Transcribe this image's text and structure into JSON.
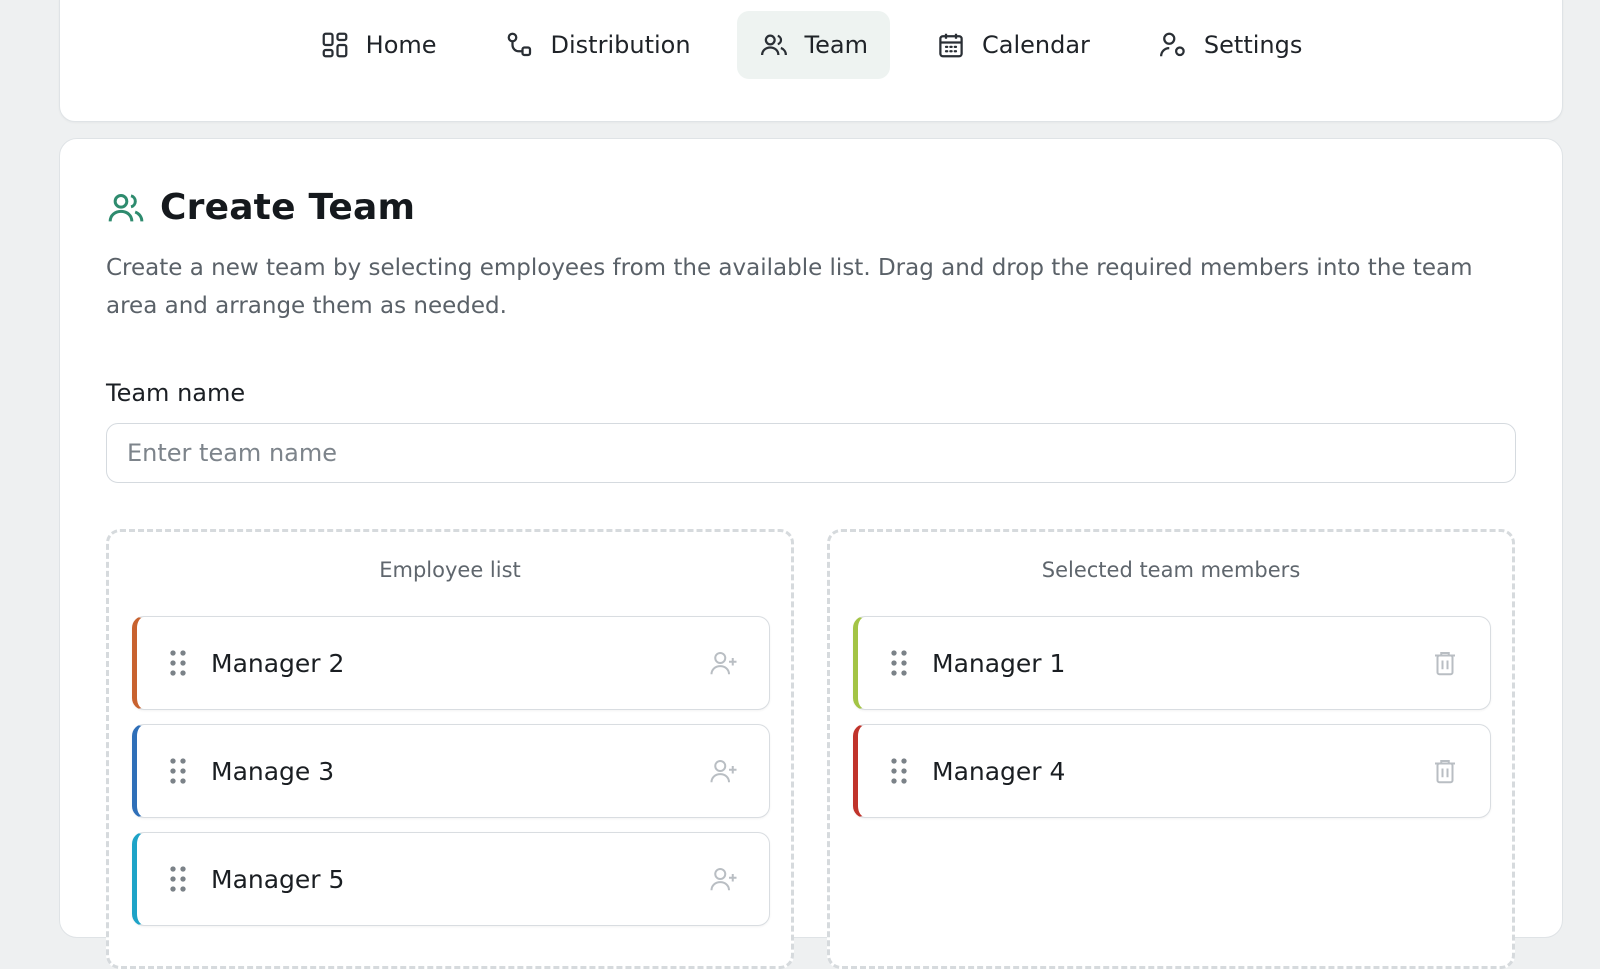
{
  "nav": {
    "items": [
      {
        "label": "Home",
        "icon": "home-grid-icon"
      },
      {
        "label": "Distribution",
        "icon": "distribution-icon"
      },
      {
        "label": "Team",
        "icon": "team-icon",
        "active": true
      },
      {
        "label": "Calendar",
        "icon": "calendar-icon"
      },
      {
        "label": "Settings",
        "icon": "settings-user-icon"
      }
    ]
  },
  "page": {
    "title": "Create Team",
    "description": "Create a new team by selecting employees from the available list. Drag and drop the required members into the team area and arrange them as needed."
  },
  "form": {
    "team_name_label": "Team name",
    "team_name_placeholder": "Enter team name",
    "team_name_value": ""
  },
  "employee_list": {
    "title": "Employee list",
    "items": [
      {
        "name": "Manager 2",
        "color": "#c8622f"
      },
      {
        "name": "Manage 3",
        "color": "#2f6fb8"
      },
      {
        "name": "Manager 5",
        "color": "#1ea3c7"
      }
    ]
  },
  "selected_members": {
    "title": "Selected team members",
    "items": [
      {
        "name": "Manager 1",
        "color": "#a3c445"
      },
      {
        "name": "Manager 4",
        "color": "#c0332b"
      }
    ]
  },
  "colors": {
    "accent": "#2e8b6e",
    "active_nav_bg": "#eef3f1"
  }
}
